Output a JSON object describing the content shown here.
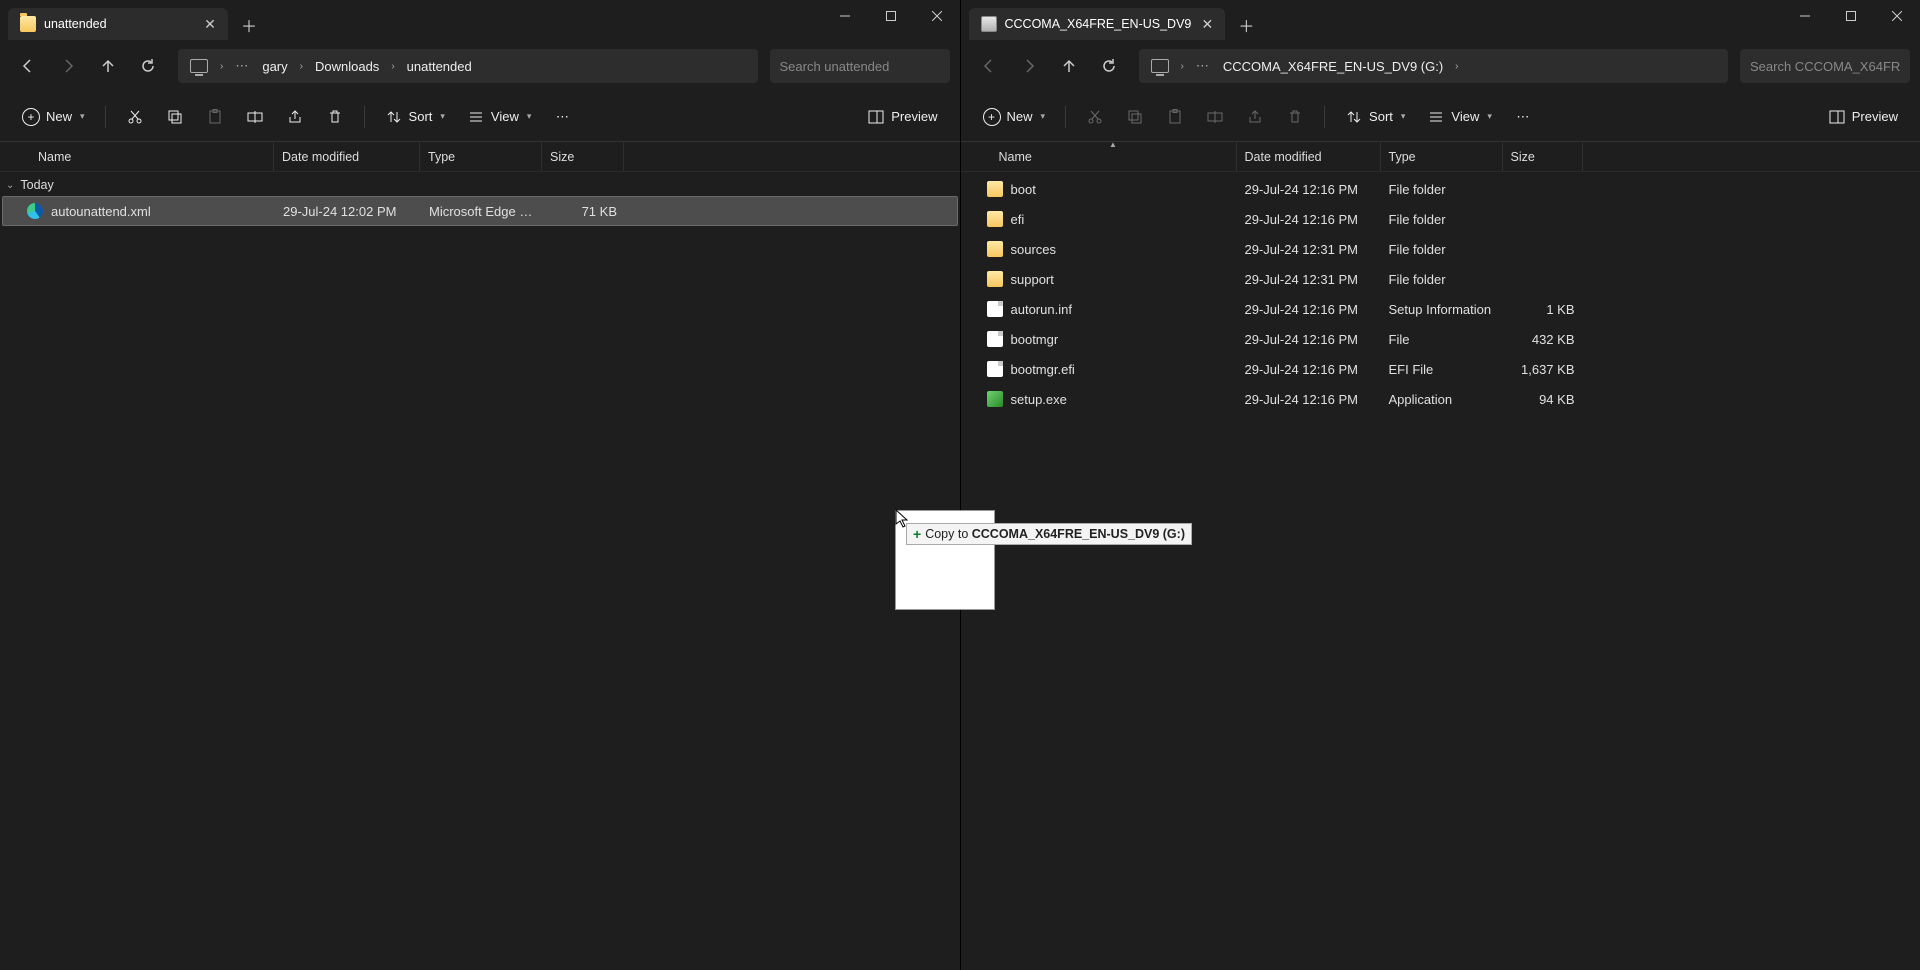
{
  "leftWindow": {
    "tabTitle": "unattended",
    "breadcrumbs": [
      "gary",
      "Downloads",
      "unattended"
    ],
    "searchPlaceholder": "Search unattended",
    "toolbar": {
      "new": "New",
      "sort": "Sort",
      "view": "View",
      "preview": "Preview"
    },
    "columns": {
      "name": "Name",
      "date": "Date modified",
      "type": "Type",
      "size": "Size"
    },
    "group": "Today",
    "rows": [
      {
        "icon": "edge",
        "name": "autounattend.xml",
        "date": "29-Jul-24 12:02 PM",
        "type": "Microsoft Edge HT...",
        "size": "71 KB",
        "selected": true
      }
    ]
  },
  "rightWindow": {
    "tabTitle": "CCCOMA_X64FRE_EN-US_DV9",
    "breadcrumbs": [
      "CCCOMA_X64FRE_EN-US_DV9 (G:)"
    ],
    "searchPlaceholder": "Search CCCOMA_X64FR",
    "toolbar": {
      "new": "New",
      "sort": "Sort",
      "view": "View",
      "preview": "Preview"
    },
    "columns": {
      "name": "Name",
      "date": "Date modified",
      "type": "Type",
      "size": "Size"
    },
    "rows": [
      {
        "icon": "folder",
        "name": "boot",
        "date": "29-Jul-24 12:16 PM",
        "type": "File folder",
        "size": ""
      },
      {
        "icon": "folder",
        "name": "efi",
        "date": "29-Jul-24 12:16 PM",
        "type": "File folder",
        "size": ""
      },
      {
        "icon": "folder",
        "name": "sources",
        "date": "29-Jul-24 12:31 PM",
        "type": "File folder",
        "size": ""
      },
      {
        "icon": "folder",
        "name": "support",
        "date": "29-Jul-24 12:31 PM",
        "type": "File folder",
        "size": ""
      },
      {
        "icon": "doc",
        "name": "autorun.inf",
        "date": "29-Jul-24 12:16 PM",
        "type": "Setup Information",
        "size": "1 KB"
      },
      {
        "icon": "doc",
        "name": "bootmgr",
        "date": "29-Jul-24 12:16 PM",
        "type": "File",
        "size": "432 KB"
      },
      {
        "icon": "doc",
        "name": "bootmgr.efi",
        "date": "29-Jul-24 12:16 PM",
        "type": "EFI File",
        "size": "1,637 KB"
      },
      {
        "icon": "exe",
        "name": "setup.exe",
        "date": "29-Jul-24 12:16 PM",
        "type": "Application",
        "size": "94 KB"
      }
    ]
  },
  "drag": {
    "hintPrefix": "Copy to ",
    "hintTarget": "CCCOMA_X64FRE_EN-US_DV9 (G:)"
  }
}
